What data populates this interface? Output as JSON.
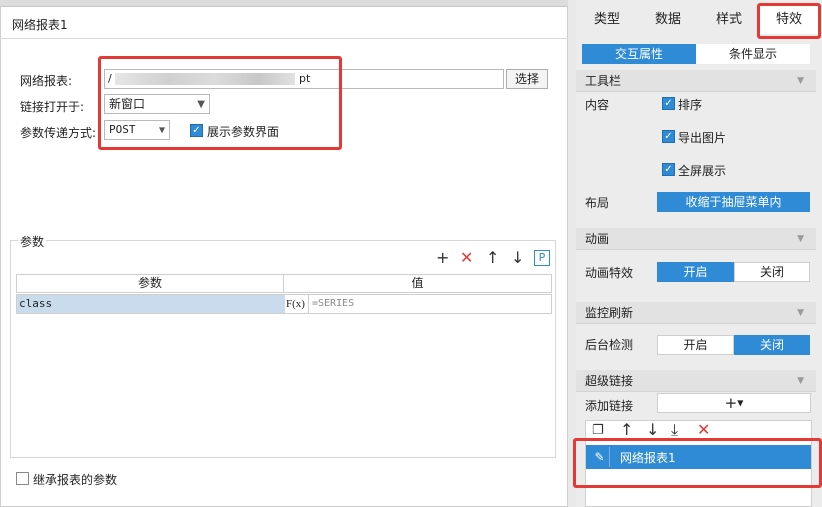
{
  "dialog": {
    "title": "网络报表1",
    "report_label": "网络报表:",
    "report_value_prefix": "/",
    "report_value_suffix": "pt",
    "select_button": "选择",
    "open_label": "链接打开于:",
    "open_value": "新窗口",
    "method_label": "参数传递方式:",
    "method_value": "POST",
    "show_params_label": "展示参数界面",
    "params_group_label": "参数",
    "params_columns": [
      "参数",
      "值"
    ],
    "params_rows": [
      {
        "name": "class",
        "value": "=SERIES"
      }
    ],
    "inherit_label": "继承报表的参数"
  },
  "panel": {
    "tabs": [
      "类型",
      "数据",
      "样式",
      "特效"
    ],
    "subtabs": [
      "交互属性",
      "条件显示"
    ],
    "toolbar": {
      "section": "工具栏",
      "content_label": "内容",
      "options": [
        "排序",
        "导出图片",
        "全屏展示"
      ],
      "layout_label": "布局",
      "layout_value": "收缩于抽屉菜单内"
    },
    "animation": {
      "section": "动画",
      "label": "动画特效",
      "on": "开启",
      "off": "关闭"
    },
    "monitor": {
      "section": "监控刷新",
      "label": "后台检测",
      "on": "开启",
      "off": "关闭"
    },
    "hyperlink": {
      "section": "超级链接",
      "add_label": "添加链接",
      "items": [
        "网络报表1"
      ]
    }
  },
  "colors": {
    "accent": "#2f8bd6",
    "highlight": "#e53935",
    "row_select": "#c8dcee"
  }
}
